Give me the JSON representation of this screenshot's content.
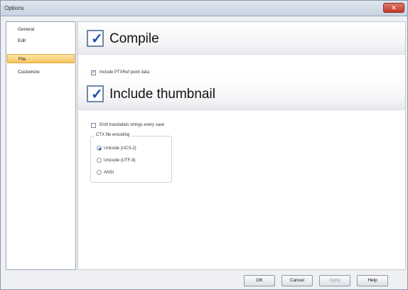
{
  "window": {
    "title": "Options",
    "close_glyph": "✕"
  },
  "nav": {
    "items": [
      {
        "label": "General",
        "selected": false
      },
      {
        "label": "Edit",
        "selected": false
      },
      {
        "label": "File",
        "selected": true
      },
      {
        "label": "Customize",
        "selected": false
      }
    ]
  },
  "content": {
    "compile": {
      "label": "Compile",
      "checked": true
    },
    "include_ptxref": {
      "label": "Include PTXRef point data",
      "checked": true
    },
    "include_thumbnail": {
      "label": "Include thumbnail",
      "checked": true
    },
    "emit_strings": {
      "label": "Emit translation strings every save",
      "checked": false
    },
    "encoding_group": {
      "title": "CTX file encoding",
      "options": [
        {
          "label": "Unicode (UCS-2)",
          "selected": true
        },
        {
          "label": "Unicode (UTF-8)",
          "selected": false
        },
        {
          "label": "ANSI",
          "selected": false
        }
      ]
    }
  },
  "buttons": {
    "ok": "OK",
    "cancel": "Cancel",
    "apply": "Apply",
    "help": "Help"
  },
  "colors": {
    "selection_bg": "#f7c65f",
    "check_blue": "#1e4fb0",
    "close_red": "#c0392b"
  }
}
